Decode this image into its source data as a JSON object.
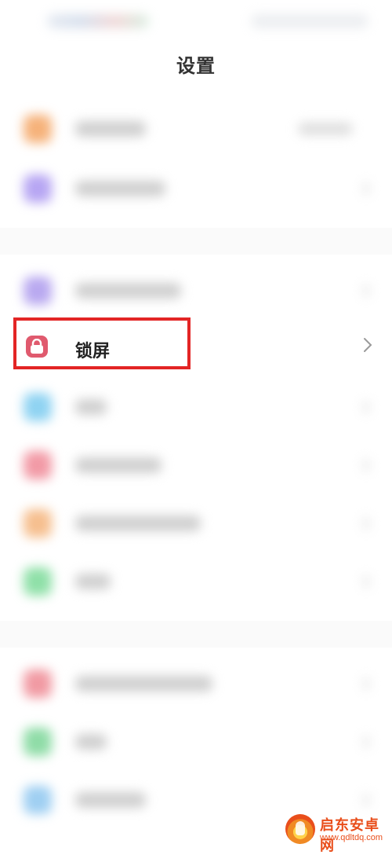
{
  "header": {
    "title": "设置"
  },
  "settings_items": [
    {
      "icon_color": "#f6b27a",
      "label_width": 90,
      "has_right_value": true
    },
    {
      "icon_color": "#b7a6f3",
      "label_width": 115,
      "has_right_value": false
    },
    {
      "icon_color": "#b9a9f0",
      "label_width": 135,
      "has_right_value": false
    },
    {
      "icon_color": "#8fd3f2",
      "label_width": 40,
      "has_right_value": false
    },
    {
      "icon_color": "#f29aa6",
      "label_width": 110,
      "has_right_value": false
    },
    {
      "icon_color": "#f6bf8f",
      "label_width": 160,
      "has_right_value": false
    },
    {
      "icon_color": "#8fe0a8",
      "label_width": 45,
      "has_right_value": false
    },
    {
      "icon_color": "#f19aa3",
      "label_width": 175,
      "has_right_value": false
    },
    {
      "icon_color": "#8fdca7",
      "label_width": 40,
      "has_right_value": false
    },
    {
      "icon_color": "#9fcff2",
      "label_width": 90,
      "has_right_value": false
    }
  ],
  "highlighted_item": {
    "label": "锁屏",
    "icon": "lock-icon",
    "icon_color": "#e05a6e",
    "highlight_color": "#e32525"
  },
  "watermark": {
    "text": "启东安卓网",
    "url": "www.qdltdq.com"
  }
}
